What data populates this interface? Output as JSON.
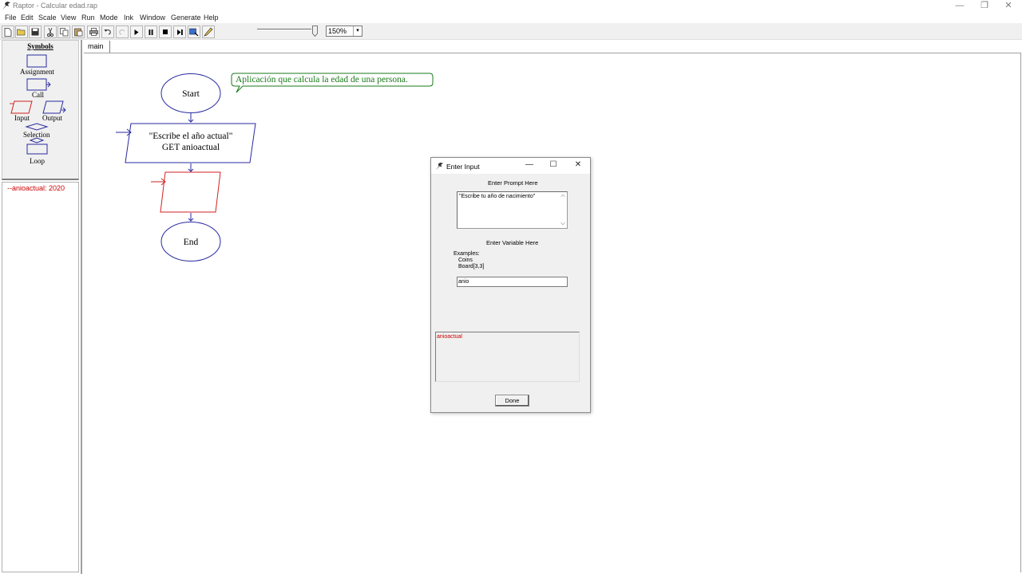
{
  "window": {
    "title": "Raptor - Calcular edad.rap",
    "controls": [
      "—",
      "❐",
      "✕"
    ]
  },
  "menu": [
    "File",
    "Edit",
    "Scale",
    "View",
    "Run",
    "Mode",
    "Ink",
    "Window",
    "Generate",
    "Help"
  ],
  "toolbar": {
    "zoom_value": "150%",
    "zoom_arrow": "▾"
  },
  "symbols": {
    "title": "Symbols",
    "assignment": "Assignment",
    "call": "Call",
    "input": "Input",
    "output": "Output",
    "selection": "Selection",
    "loop": "Loop"
  },
  "watch": {
    "items": [
      "--anioactual: 2020"
    ]
  },
  "tabs": {
    "main": "main"
  },
  "flowchart": {
    "start": "Start",
    "end": "End",
    "input_prompt": "\"Escribe el año actual\"",
    "input_get": "GET anioactual",
    "comment": "Aplicación que calcula la edad de una persona."
  },
  "dialog": {
    "title": "Enter Input",
    "controls": [
      "—",
      "☐",
      "✕"
    ],
    "prompt_label": "Enter Prompt Here",
    "prompt_text": "\"Escribe tu año de nacimiento\"",
    "variable_label": "Enter Variable Here",
    "examples_label": "Examples:",
    "example_1": "Coins",
    "example_2": "Board[3,3]",
    "variable_value": "anio",
    "suggestion": "anioactual",
    "done": "Done"
  },
  "colors": {
    "flow_blue": "#2a2aa0",
    "flow_red": "#d02020",
    "comment_green": "#1a7a1a",
    "watch_red": "#cc0000"
  }
}
